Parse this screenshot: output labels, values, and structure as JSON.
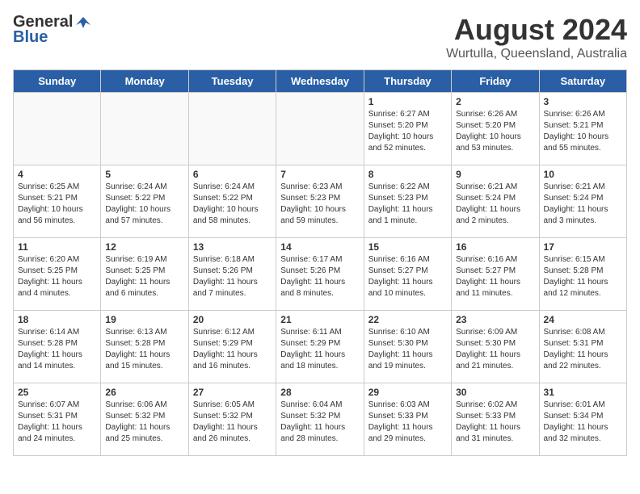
{
  "header": {
    "logo_general": "General",
    "logo_blue": "Blue",
    "month_title": "August 2024",
    "location": "Wurtulla, Queensland, Australia"
  },
  "days_of_week": [
    "Sunday",
    "Monday",
    "Tuesday",
    "Wednesday",
    "Thursday",
    "Friday",
    "Saturday"
  ],
  "weeks": [
    [
      {
        "day": "",
        "info": ""
      },
      {
        "day": "",
        "info": ""
      },
      {
        "day": "",
        "info": ""
      },
      {
        "day": "",
        "info": ""
      },
      {
        "day": "1",
        "info": "Sunrise: 6:27 AM\nSunset: 5:20 PM\nDaylight: 10 hours\nand 52 minutes."
      },
      {
        "day": "2",
        "info": "Sunrise: 6:26 AM\nSunset: 5:20 PM\nDaylight: 10 hours\nand 53 minutes."
      },
      {
        "day": "3",
        "info": "Sunrise: 6:26 AM\nSunset: 5:21 PM\nDaylight: 10 hours\nand 55 minutes."
      }
    ],
    [
      {
        "day": "4",
        "info": "Sunrise: 6:25 AM\nSunset: 5:21 PM\nDaylight: 10 hours\nand 56 minutes."
      },
      {
        "day": "5",
        "info": "Sunrise: 6:24 AM\nSunset: 5:22 PM\nDaylight: 10 hours\nand 57 minutes."
      },
      {
        "day": "6",
        "info": "Sunrise: 6:24 AM\nSunset: 5:22 PM\nDaylight: 10 hours\nand 58 minutes."
      },
      {
        "day": "7",
        "info": "Sunrise: 6:23 AM\nSunset: 5:23 PM\nDaylight: 10 hours\nand 59 minutes."
      },
      {
        "day": "8",
        "info": "Sunrise: 6:22 AM\nSunset: 5:23 PM\nDaylight: 11 hours\nand 1 minute."
      },
      {
        "day": "9",
        "info": "Sunrise: 6:21 AM\nSunset: 5:24 PM\nDaylight: 11 hours\nand 2 minutes."
      },
      {
        "day": "10",
        "info": "Sunrise: 6:21 AM\nSunset: 5:24 PM\nDaylight: 11 hours\nand 3 minutes."
      }
    ],
    [
      {
        "day": "11",
        "info": "Sunrise: 6:20 AM\nSunset: 5:25 PM\nDaylight: 11 hours\nand 4 minutes."
      },
      {
        "day": "12",
        "info": "Sunrise: 6:19 AM\nSunset: 5:25 PM\nDaylight: 11 hours\nand 6 minutes."
      },
      {
        "day": "13",
        "info": "Sunrise: 6:18 AM\nSunset: 5:26 PM\nDaylight: 11 hours\nand 7 minutes."
      },
      {
        "day": "14",
        "info": "Sunrise: 6:17 AM\nSunset: 5:26 PM\nDaylight: 11 hours\nand 8 minutes."
      },
      {
        "day": "15",
        "info": "Sunrise: 6:16 AM\nSunset: 5:27 PM\nDaylight: 11 hours\nand 10 minutes."
      },
      {
        "day": "16",
        "info": "Sunrise: 6:16 AM\nSunset: 5:27 PM\nDaylight: 11 hours\nand 11 minutes."
      },
      {
        "day": "17",
        "info": "Sunrise: 6:15 AM\nSunset: 5:28 PM\nDaylight: 11 hours\nand 12 minutes."
      }
    ],
    [
      {
        "day": "18",
        "info": "Sunrise: 6:14 AM\nSunset: 5:28 PM\nDaylight: 11 hours\nand 14 minutes."
      },
      {
        "day": "19",
        "info": "Sunrise: 6:13 AM\nSunset: 5:28 PM\nDaylight: 11 hours\nand 15 minutes."
      },
      {
        "day": "20",
        "info": "Sunrise: 6:12 AM\nSunset: 5:29 PM\nDaylight: 11 hours\nand 16 minutes."
      },
      {
        "day": "21",
        "info": "Sunrise: 6:11 AM\nSunset: 5:29 PM\nDaylight: 11 hours\nand 18 minutes."
      },
      {
        "day": "22",
        "info": "Sunrise: 6:10 AM\nSunset: 5:30 PM\nDaylight: 11 hours\nand 19 minutes."
      },
      {
        "day": "23",
        "info": "Sunrise: 6:09 AM\nSunset: 5:30 PM\nDaylight: 11 hours\nand 21 minutes."
      },
      {
        "day": "24",
        "info": "Sunrise: 6:08 AM\nSunset: 5:31 PM\nDaylight: 11 hours\nand 22 minutes."
      }
    ],
    [
      {
        "day": "25",
        "info": "Sunrise: 6:07 AM\nSunset: 5:31 PM\nDaylight: 11 hours\nand 24 minutes."
      },
      {
        "day": "26",
        "info": "Sunrise: 6:06 AM\nSunset: 5:32 PM\nDaylight: 11 hours\nand 25 minutes."
      },
      {
        "day": "27",
        "info": "Sunrise: 6:05 AM\nSunset: 5:32 PM\nDaylight: 11 hours\nand 26 minutes."
      },
      {
        "day": "28",
        "info": "Sunrise: 6:04 AM\nSunset: 5:32 PM\nDaylight: 11 hours\nand 28 minutes."
      },
      {
        "day": "29",
        "info": "Sunrise: 6:03 AM\nSunset: 5:33 PM\nDaylight: 11 hours\nand 29 minutes."
      },
      {
        "day": "30",
        "info": "Sunrise: 6:02 AM\nSunset: 5:33 PM\nDaylight: 11 hours\nand 31 minutes."
      },
      {
        "day": "31",
        "info": "Sunrise: 6:01 AM\nSunset: 5:34 PM\nDaylight: 11 hours\nand 32 minutes."
      }
    ]
  ]
}
